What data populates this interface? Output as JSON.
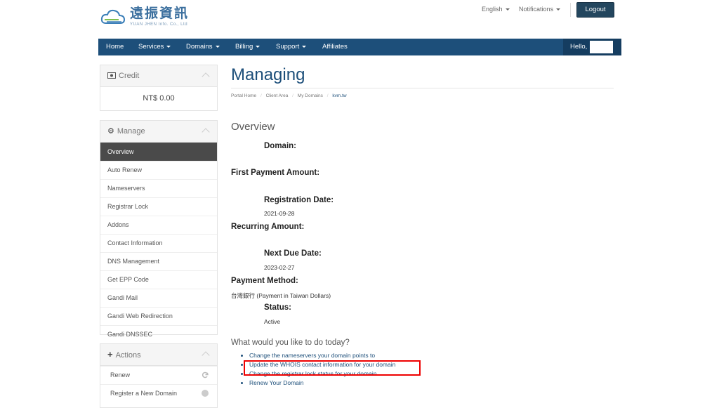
{
  "brand": {
    "name_cn": "遠振資訊",
    "name_en": "YUAN JHEN Info. Co., Ltd",
    "cloud_color": "#3b7fb8"
  },
  "topbar": {
    "language": "English",
    "notifications": "Notifications",
    "logout": "Logout"
  },
  "nav": {
    "items": [
      "Home",
      "Services",
      "Domains",
      "Billing",
      "Support",
      "Affiliates"
    ],
    "hello": "Hello,",
    "bg_color": "#1d4f7a"
  },
  "sidebar": {
    "credit": {
      "title": "Credit",
      "amount": "NT$ 0.00"
    },
    "manage": {
      "title": "Manage",
      "items": [
        "Overview",
        "Auto Renew",
        "Nameservers",
        "Registrar Lock",
        "Addons",
        "Contact Information",
        "DNS Management",
        "Get EPP Code",
        "Gandi Mail",
        "Gandi Web Redirection",
        "Gandi DNSSEC"
      ],
      "active_index": 0
    },
    "actions": {
      "title": "Actions",
      "items": [
        "Renew",
        "Register a New Domain"
      ]
    }
  },
  "main": {
    "title": "Managing",
    "breadcrumb": [
      "Portal Home",
      "Client Area",
      "My Domains",
      "kvm.tw"
    ],
    "section_title": "Overview",
    "fields": {
      "domain_label": "Domain:",
      "first_payment_label": "First Payment Amount:",
      "registration_label": "Registration Date:",
      "registration_value": "2021-09-28",
      "recurring_label": "Recurring Amount:",
      "next_due_label": "Next Due Date:",
      "next_due_value": "2023-02-27",
      "payment_method_label": "Payment Method:",
      "payment_method_value": "台灣銀行 (Payment in Taiwan Dollars)",
      "status_label": "Status:",
      "status_value": "Active"
    },
    "question": "What would you like to do today?",
    "actions": [
      "Change the nameservers your domain points to",
      "Update the WHOIS contact information for your domain",
      "Change the registrar lock status for your domain",
      "Renew Your Domain"
    ],
    "highlight_color": "#e00000"
  }
}
